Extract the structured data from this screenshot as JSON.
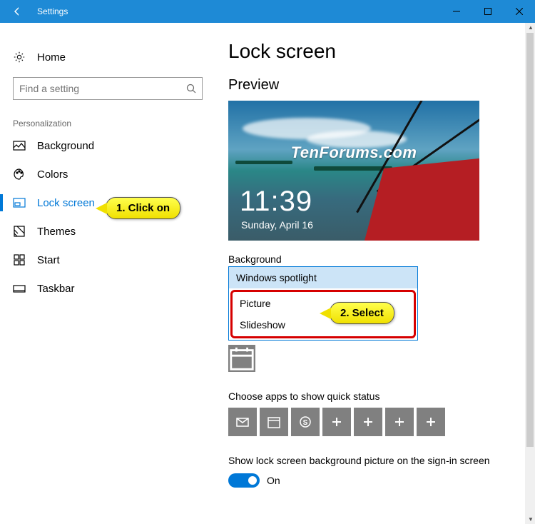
{
  "window": {
    "title": "Settings"
  },
  "sidebar": {
    "home": "Home",
    "search_placeholder": "Find a setting",
    "section": "Personalization",
    "items": [
      {
        "label": "Background"
      },
      {
        "label": "Colors"
      },
      {
        "label": "Lock screen"
      },
      {
        "label": "Themes"
      },
      {
        "label": "Start"
      },
      {
        "label": "Taskbar"
      }
    ]
  },
  "page": {
    "title": "Lock screen",
    "preview_header": "Preview",
    "preview_time": "11:39",
    "preview_date": "Sunday, April 16",
    "preview_watermark": "TenForums.com",
    "bg_label": "Background",
    "bg_options": [
      "Windows spotlight",
      "Picture",
      "Slideshow"
    ],
    "quick_status_label": "Choose apps to show quick status",
    "toggle_label": "Show lock screen background picture on the sign-in screen",
    "toggle_state": "On"
  },
  "annotations": {
    "step1": "1. Click on",
    "step2": "2. Select"
  }
}
